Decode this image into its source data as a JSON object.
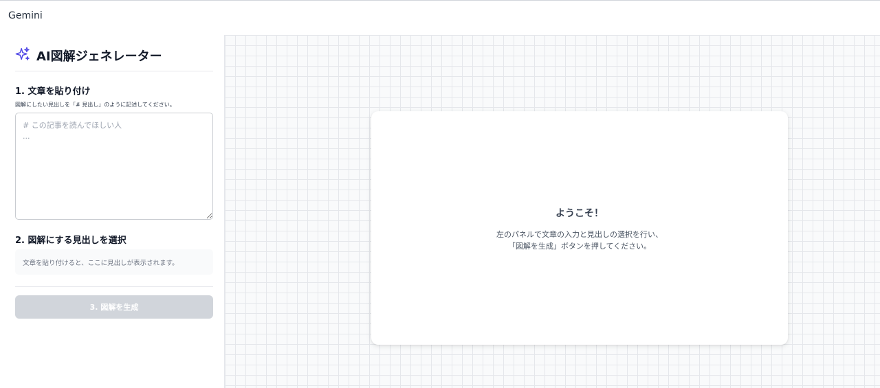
{
  "app": {
    "title": "Gemini"
  },
  "sidebar": {
    "title": "AI図解ジェネレーター",
    "icon": "sparkles-icon",
    "accent_color": "#4f46e5",
    "step1": {
      "label": "1. 文章を貼り付け",
      "hint": "図解にしたい見出しを「# 見出し」のように記述してください。",
      "placeholder": "# この記事を読んでほしい人\n..."
    },
    "step2": {
      "label": "2. 図解にする見出しを選択",
      "empty_message": "文章を貼り付けると、ここに見出しが表示されます。"
    },
    "generate_button": {
      "label": "3. 図解を生成",
      "disabled": true
    }
  },
  "main": {
    "welcome": {
      "title": "ようこそ！",
      "line1": "左のパネルで文章の入力と見出しの選択を行い、",
      "line2": "「図解を生成」ボタンを押してください。"
    }
  }
}
